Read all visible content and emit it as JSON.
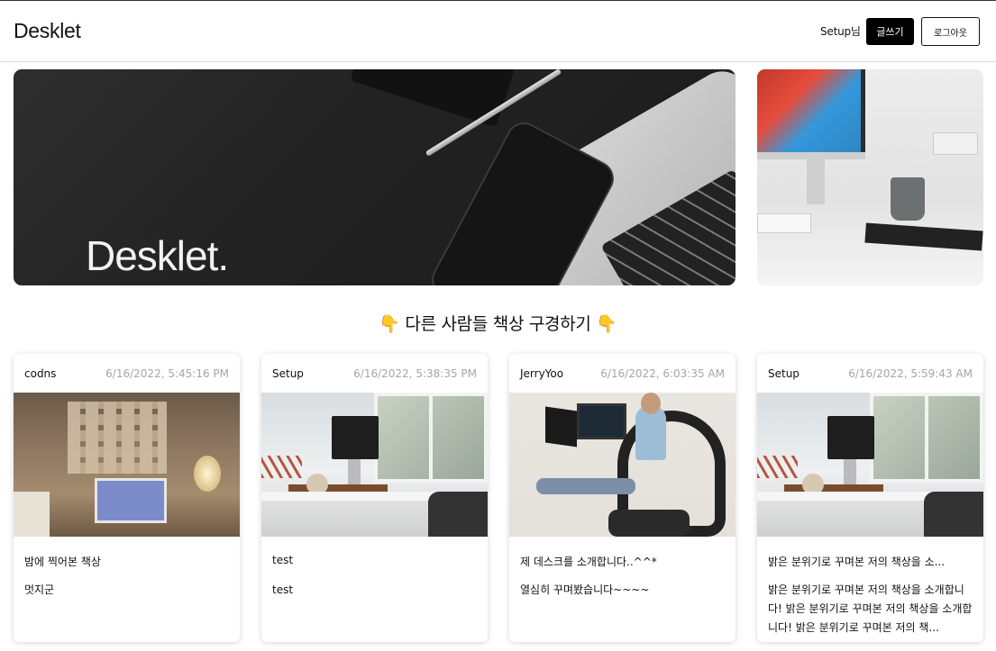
{
  "header": {
    "logo": "Desklet",
    "user_label": "Setup님",
    "write_label": "글쓰기",
    "logout_label": "로그아웃"
  },
  "hero": {
    "title": "Desklet."
  },
  "section": {
    "title": "👇 다른 사람들 책상 구경하기 👇"
  },
  "posts": [
    {
      "author": "codns",
      "date": "6/16/2022, 5:45:16 PM",
      "title": "밤에 찍어본 책상",
      "body": "멋지군"
    },
    {
      "author": "Setup",
      "date": "6/16/2022, 5:38:35 PM",
      "title": "test",
      "body": "test"
    },
    {
      "author": "JerryYoo",
      "date": "6/16/2022, 6:03:35 AM",
      "title": "제 데스크를 소개합니다..^^*",
      "body": "열심히 꾸며봤습니다~~~~"
    },
    {
      "author": "Setup",
      "date": "6/16/2022, 5:59:43 AM",
      "title": "밝은 분위기로 꾸며본 저의 책상을 소...",
      "body": "밝은 분위기로 꾸며본 저의 책상을 소개합니다! 밝은 분위기로 꾸며본 저의 책상을 소개합니다! 밝은 분위기로 꾸며본 저의 책..."
    }
  ],
  "colors": {
    "primary_button": "#000000",
    "date_text": "#a6a6a6",
    "divider": "#d9d9d9"
  }
}
